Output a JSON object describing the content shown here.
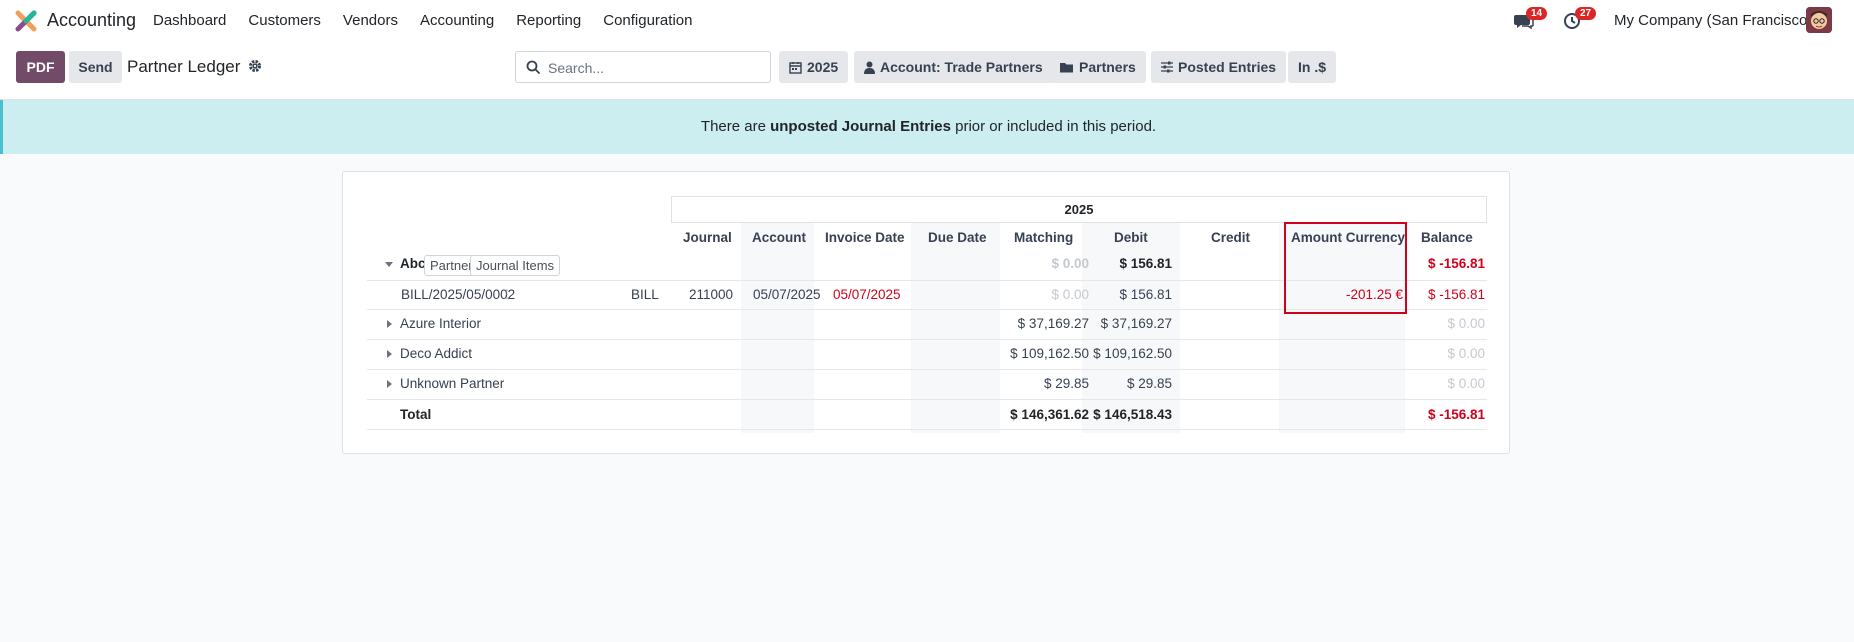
{
  "navbar": {
    "app_title": "Accounting",
    "menu": [
      "Dashboard",
      "Customers",
      "Vendors",
      "Accounting",
      "Reporting",
      "Configuration"
    ],
    "messages_count": "14",
    "activities_count": "27",
    "company": "My Company (San Francisco)"
  },
  "controls": {
    "pdf_label": "PDF",
    "send_label": "Send",
    "report_title": "Partner Ledger",
    "search_placeholder": "Search...",
    "filters": {
      "date": "2025",
      "account": "Account: Trade Partners",
      "partners": "Partners",
      "posted": "Posted Entries",
      "currency": "In .$"
    }
  },
  "alert": {
    "prefix": "There are ",
    "link": "unposted Journal Entries",
    "suffix": " prior or included in this period."
  },
  "report": {
    "period": "2025",
    "columns": {
      "journal": "Journal",
      "account": "Account",
      "invoice_date": "Invoice Date",
      "due_date": "Due Date",
      "matching": "Matching",
      "debit": "Debit",
      "credit": "Credit",
      "amount_currency": "Amount Currency",
      "balance": "Balance"
    },
    "rows": {
      "abc": {
        "name": "Abc",
        "tag_partner": "Partner",
        "tag_items": "Journal Items",
        "debit": "$ 0.00",
        "credit": "$ 156.81",
        "balance": "$ -156.81"
      },
      "bill": {
        "name": "BILL/2025/05/0002",
        "journal": "BILL",
        "account": "211000",
        "invoice_date": "05/07/2025",
        "due_date": "05/07/2025",
        "debit": "$ 0.00",
        "credit": "$ 156.81",
        "amount_currency": "-201.25 €",
        "balance": "$ -156.81"
      },
      "azure": {
        "name": "Azure Interior",
        "debit": "$ 37,169.27",
        "credit": "$ 37,169.27",
        "balance": "$ 0.00"
      },
      "deco": {
        "name": "Deco Addict",
        "debit": "$ 109,162.50",
        "credit": "$ 109,162.50",
        "balance": "$ 0.00"
      },
      "unknown": {
        "name": "Unknown Partner",
        "debit": "$ 29.85",
        "credit": "$ 29.85",
        "balance": "$ 0.00"
      },
      "total": {
        "name": "Total",
        "debit": "$ 146,361.62",
        "credit": "$ 146,518.43",
        "balance": "$ -156.81"
      }
    }
  },
  "colors": {
    "brand": "#714b67",
    "alert_bg": "#cdeef1",
    "negative": "#d0021b",
    "highlight": "#d0021b"
  },
  "icons": [
    "odoo-logo-icon",
    "chat-icon",
    "clock-icon",
    "gear-icon",
    "search-icon",
    "calendar-icon",
    "user-icon",
    "folder-icon",
    "sliders-icon",
    "caret-down-icon",
    "caret-right-icon",
    "kebab-icon"
  ]
}
